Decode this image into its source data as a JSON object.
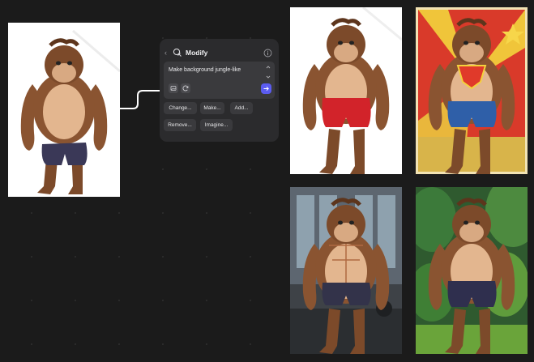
{
  "panel": {
    "back_icon": "chevron-left-icon",
    "title": "Modify",
    "title_icon": "modify-icon",
    "info_icon": "info-icon",
    "prompt_text": "Make background jungle-like",
    "tool_icons": [
      "image-icon",
      "refresh-icon"
    ],
    "send_icon": "arrow-right-icon",
    "accent_color": "#5b5cf0",
    "suggestions": [
      "Change...",
      "Make...",
      "Add...",
      "Remove...",
      "Imagine..."
    ]
  },
  "images": {
    "source": "gorilla character with navy shorts",
    "outputs": [
      "gorilla in red shorts on white background",
      "gorilla in superman shirt comic panel",
      "muscular gorilla in gym",
      "gorilla in jungle background"
    ]
  }
}
